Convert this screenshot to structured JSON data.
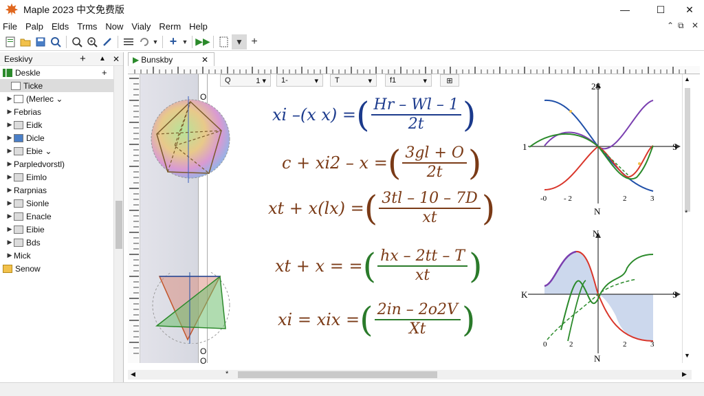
{
  "window": {
    "title": "Maple 2023 中文免费版",
    "minimize": "—",
    "maximize": "☐",
    "close": "✕"
  },
  "menu": [
    "File",
    "Palp",
    "Elds",
    "Trms",
    "Now",
    "Vialy",
    "Rerm",
    "Help"
  ],
  "mdi": {
    "restore": "⌃",
    "copy": "⧉",
    "close": "✕"
  },
  "palette": {
    "header": "Eeskivy",
    "plus": "+",
    "close": "✕",
    "root": "Deskle",
    "root_plus": "+",
    "items": [
      {
        "label": "Ticke",
        "arrow": "",
        "selected": true
      },
      {
        "label": "(Merlec ⌄",
        "arrow": "▶"
      },
      {
        "label": "Febrias",
        "arrow": "▶"
      },
      {
        "label": "Eidk",
        "arrow": "▶"
      },
      {
        "label": "Dicle",
        "arrow": "▶"
      },
      {
        "label": "Ebie ⌄",
        "arrow": "▶"
      },
      {
        "label": "Parpledvorstl)",
        "arrow": "▶"
      },
      {
        "label": "Eimlo",
        "arrow": "▶"
      },
      {
        "label": "Rarpnias",
        "arrow": "▶"
      },
      {
        "label": "Sionle",
        "arrow": "▶"
      },
      {
        "label": "Enacle",
        "arrow": "▶"
      },
      {
        "label": "Eibie",
        "arrow": "▶"
      },
      {
        "label": "Bds",
        "arrow": "▶"
      },
      {
        "label": "Mick",
        "arrow": "▶"
      }
    ],
    "footer": "Senow"
  },
  "doc": {
    "tab": "Bunskby",
    "tab_close": "✕",
    "controls": [
      {
        "value": "Q",
        "arrow": "1 ▾"
      },
      {
        "value": "1-",
        "arrow": "▾"
      },
      {
        "value": "T",
        "arrow": "▾"
      },
      {
        "value": "f1",
        "arrow": "▾"
      },
      {
        "value": "⊞",
        "arrow": ""
      }
    ],
    "gutter_marks": [
      "O",
      "O",
      "O"
    ]
  },
  "equations": [
    {
      "lhs": "xi –(x x) =",
      "num": "Hr – Wl – 1",
      "den": "2t",
      "color": "#1b3a8c"
    },
    {
      "lhs": "c + xi2 – x =",
      "num": "3gl + O",
      "den": "2t",
      "color": "#7a3a16"
    },
    {
      "lhs": "xt + x(lx) =",
      "num": "3tl – 10 – 7D",
      "den": "xt",
      "color": "#7a3a16"
    },
    {
      "lhs": "xt + x = =",
      "num": "hx – 2tt – T",
      "den": "xt",
      "color": "#7a3a16",
      "frac_color": "#2a7a2a"
    },
    {
      "lhs": "xi = xix =",
      "num": "2in – 2o2V",
      "den": "Xt",
      "color": "#7a3a16",
      "frac_color": "#2a7a2a"
    }
  ],
  "plot1": {
    "top": "2S",
    "left": "1",
    "right": "S",
    "bottom": "N",
    "ticks": [
      "-0",
      "- 2",
      "2",
      "3"
    ]
  },
  "plot2": {
    "top": "N",
    "left": "K",
    "right": "S",
    "bottom": "N",
    "ticks": [
      "0",
      "2",
      "2",
      "3"
    ]
  },
  "colors": {
    "blue": "#1f4fa8",
    "green": "#2b8a2b",
    "red": "#d9362b",
    "purple": "#7a3fb0",
    "brown": "#7a3a16"
  }
}
